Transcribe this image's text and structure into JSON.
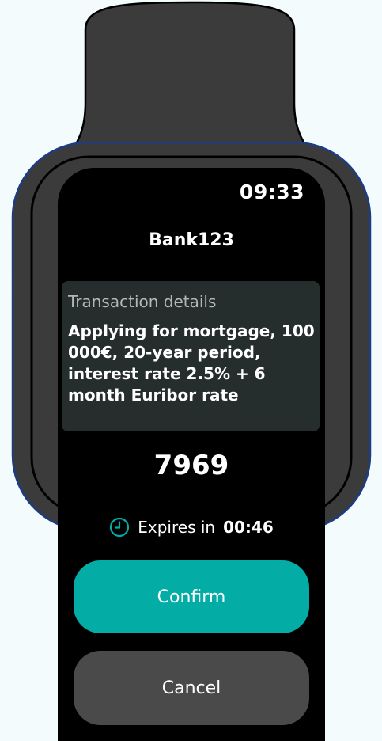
{
  "status": {
    "time": "09:33"
  },
  "app": {
    "title": "Bank123"
  },
  "transaction": {
    "label": "Transaction details",
    "description": "Applying for mortgage, 100 000€, 20-year period, interest rate 2.5% + 6 month Euribor rate"
  },
  "verification": {
    "code": "7969"
  },
  "expiry": {
    "label": "Expires in",
    "time": "00:46",
    "icon": "clock-icon"
  },
  "actions": {
    "confirm": "Confirm",
    "cancel": "Cancel"
  },
  "colors": {
    "accent": "#03ada6",
    "screen_background": "#000000",
    "card_background": "#262e2d",
    "cancel_button": "#4a4a4a",
    "watch_body": "#3a3a3a"
  }
}
